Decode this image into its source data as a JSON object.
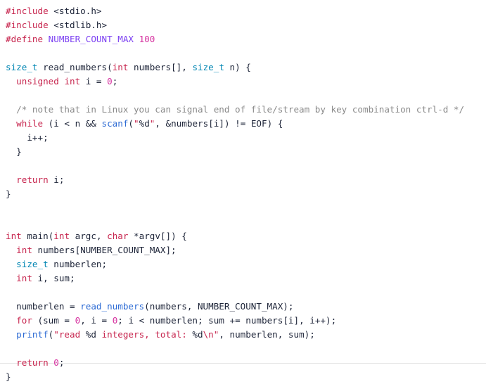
{
  "editor": {
    "language": "c",
    "background": "#ffffff",
    "default_text_color": "#1d2438",
    "bottom_rule_color": "#e2e2e2",
    "font_size_px": 12.6,
    "line_height_px": 20
  },
  "palette": {
    "preprocessor": "#c7254e",
    "keyword": "#c7254e",
    "type": "#0086b3",
    "macro_name": "#7b3ff2",
    "number": "#d633a0",
    "function_call": "#2d6bd4",
    "string": "#c7254e",
    "format_specifier": "#1d2438",
    "comment": "#8a8a8a",
    "plain": "#1d2438"
  },
  "code": {
    "lines": [
      {
        "n": 1,
        "tokens": [
          {
            "t": "#include",
            "c": "pre"
          },
          {
            "t": " ",
            "c": "plain"
          },
          {
            "t": "<stdio.h>",
            "c": "inc"
          }
        ]
      },
      {
        "n": 2,
        "tokens": [
          {
            "t": "#include",
            "c": "pre"
          },
          {
            "t": " ",
            "c": "plain"
          },
          {
            "t": "<stdlib.h>",
            "c": "inc"
          }
        ]
      },
      {
        "n": 3,
        "tokens": [
          {
            "t": "#define",
            "c": "pre"
          },
          {
            "t": " ",
            "c": "plain"
          },
          {
            "t": "NUMBER_COUNT_MAX",
            "c": "macro"
          },
          {
            "t": " ",
            "c": "plain"
          },
          {
            "t": "100",
            "c": "num"
          }
        ]
      },
      {
        "n": 4,
        "tokens": []
      },
      {
        "n": 5,
        "tokens": [
          {
            "t": "size_t",
            "c": "type"
          },
          {
            "t": " ",
            "c": "plain"
          },
          {
            "t": "read_numbers",
            "c": "plain"
          },
          {
            "t": "(",
            "c": "plain"
          },
          {
            "t": "int",
            "c": "kw"
          },
          {
            "t": " numbers[], ",
            "c": "plain"
          },
          {
            "t": "size_t",
            "c": "type"
          },
          {
            "t": " n) {",
            "c": "plain"
          }
        ]
      },
      {
        "n": 6,
        "tokens": [
          {
            "t": "  ",
            "c": "plain"
          },
          {
            "t": "unsigned",
            "c": "kw"
          },
          {
            "t": " ",
            "c": "plain"
          },
          {
            "t": "int",
            "c": "kw"
          },
          {
            "t": " i = ",
            "c": "plain"
          },
          {
            "t": "0",
            "c": "num"
          },
          {
            "t": ";",
            "c": "plain"
          }
        ]
      },
      {
        "n": 7,
        "tokens": []
      },
      {
        "n": 8,
        "tokens": [
          {
            "t": "  ",
            "c": "plain"
          },
          {
            "t": "/* note that in Linux you can signal end of file/stream by key combination ctrl-d */",
            "c": "com"
          }
        ]
      },
      {
        "n": 9,
        "tokens": [
          {
            "t": "  ",
            "c": "plain"
          },
          {
            "t": "while",
            "c": "kw"
          },
          {
            "t": " (i < n && ",
            "c": "plain"
          },
          {
            "t": "scanf",
            "c": "fn"
          },
          {
            "t": "(",
            "c": "plain"
          },
          {
            "t": "\"",
            "c": "str"
          },
          {
            "t": "%d",
            "c": "fmt"
          },
          {
            "t": "\"",
            "c": "str"
          },
          {
            "t": ", &numbers[i]) != EOF) {",
            "c": "plain"
          }
        ]
      },
      {
        "n": 10,
        "tokens": [
          {
            "t": "    i++;",
            "c": "plain"
          }
        ]
      },
      {
        "n": 11,
        "tokens": [
          {
            "t": "  }",
            "c": "plain"
          }
        ]
      },
      {
        "n": 12,
        "tokens": []
      },
      {
        "n": 13,
        "tokens": [
          {
            "t": "  ",
            "c": "plain"
          },
          {
            "t": "return",
            "c": "kw"
          },
          {
            "t": " i;",
            "c": "plain"
          }
        ]
      },
      {
        "n": 14,
        "tokens": [
          {
            "t": "}",
            "c": "plain"
          }
        ]
      },
      {
        "n": 15,
        "tokens": []
      },
      {
        "n": 16,
        "tokens": []
      },
      {
        "n": 17,
        "tokens": [
          {
            "t": "int",
            "c": "kw"
          },
          {
            "t": " ",
            "c": "plain"
          },
          {
            "t": "main",
            "c": "plain"
          },
          {
            "t": "(",
            "c": "plain"
          },
          {
            "t": "int",
            "c": "kw"
          },
          {
            "t": " argc, ",
            "c": "plain"
          },
          {
            "t": "char",
            "c": "kw"
          },
          {
            "t": " *argv[]) {",
            "c": "plain"
          }
        ]
      },
      {
        "n": 18,
        "tokens": [
          {
            "t": "  ",
            "c": "plain"
          },
          {
            "t": "int",
            "c": "kw"
          },
          {
            "t": " numbers[NUMBER_COUNT_MAX];",
            "c": "plain"
          }
        ]
      },
      {
        "n": 19,
        "tokens": [
          {
            "t": "  ",
            "c": "plain"
          },
          {
            "t": "size_t",
            "c": "type"
          },
          {
            "t": " numberlen;",
            "c": "plain"
          }
        ]
      },
      {
        "n": 20,
        "tokens": [
          {
            "t": "  ",
            "c": "plain"
          },
          {
            "t": "int",
            "c": "kw"
          },
          {
            "t": " i, sum;",
            "c": "plain"
          }
        ]
      },
      {
        "n": 21,
        "tokens": []
      },
      {
        "n": 22,
        "tokens": [
          {
            "t": "  numberlen = ",
            "c": "plain"
          },
          {
            "t": "read_numbers",
            "c": "fn"
          },
          {
            "t": "(numbers, NUMBER_COUNT_MAX);",
            "c": "plain"
          }
        ]
      },
      {
        "n": 23,
        "tokens": [
          {
            "t": "  ",
            "c": "plain"
          },
          {
            "t": "for",
            "c": "kw"
          },
          {
            "t": " (sum = ",
            "c": "plain"
          },
          {
            "t": "0",
            "c": "num"
          },
          {
            "t": ", i = ",
            "c": "plain"
          },
          {
            "t": "0",
            "c": "num"
          },
          {
            "t": "; i < numberlen; sum += numbers[i], i++);",
            "c": "plain"
          }
        ]
      },
      {
        "n": 24,
        "tokens": [
          {
            "t": "  ",
            "c": "plain"
          },
          {
            "t": "printf",
            "c": "fn"
          },
          {
            "t": "(",
            "c": "plain"
          },
          {
            "t": "\"read ",
            "c": "str"
          },
          {
            "t": "%d",
            "c": "fmt"
          },
          {
            "t": " integers, total: ",
            "c": "str"
          },
          {
            "t": "%d",
            "c": "fmt"
          },
          {
            "t": "\\n\"",
            "c": "str"
          },
          {
            "t": ", numberlen, sum);",
            "c": "plain"
          }
        ]
      },
      {
        "n": 25,
        "tokens": []
      },
      {
        "n": 26,
        "tokens": [
          {
            "t": "  ",
            "c": "plain"
          },
          {
            "t": "return",
            "c": "kw"
          },
          {
            "t": " ",
            "c": "plain"
          },
          {
            "t": "0",
            "c": "num"
          },
          {
            "t": ";",
            "c": "plain"
          }
        ]
      },
      {
        "n": 27,
        "tokens": [
          {
            "t": "}",
            "c": "plain"
          }
        ]
      }
    ]
  }
}
